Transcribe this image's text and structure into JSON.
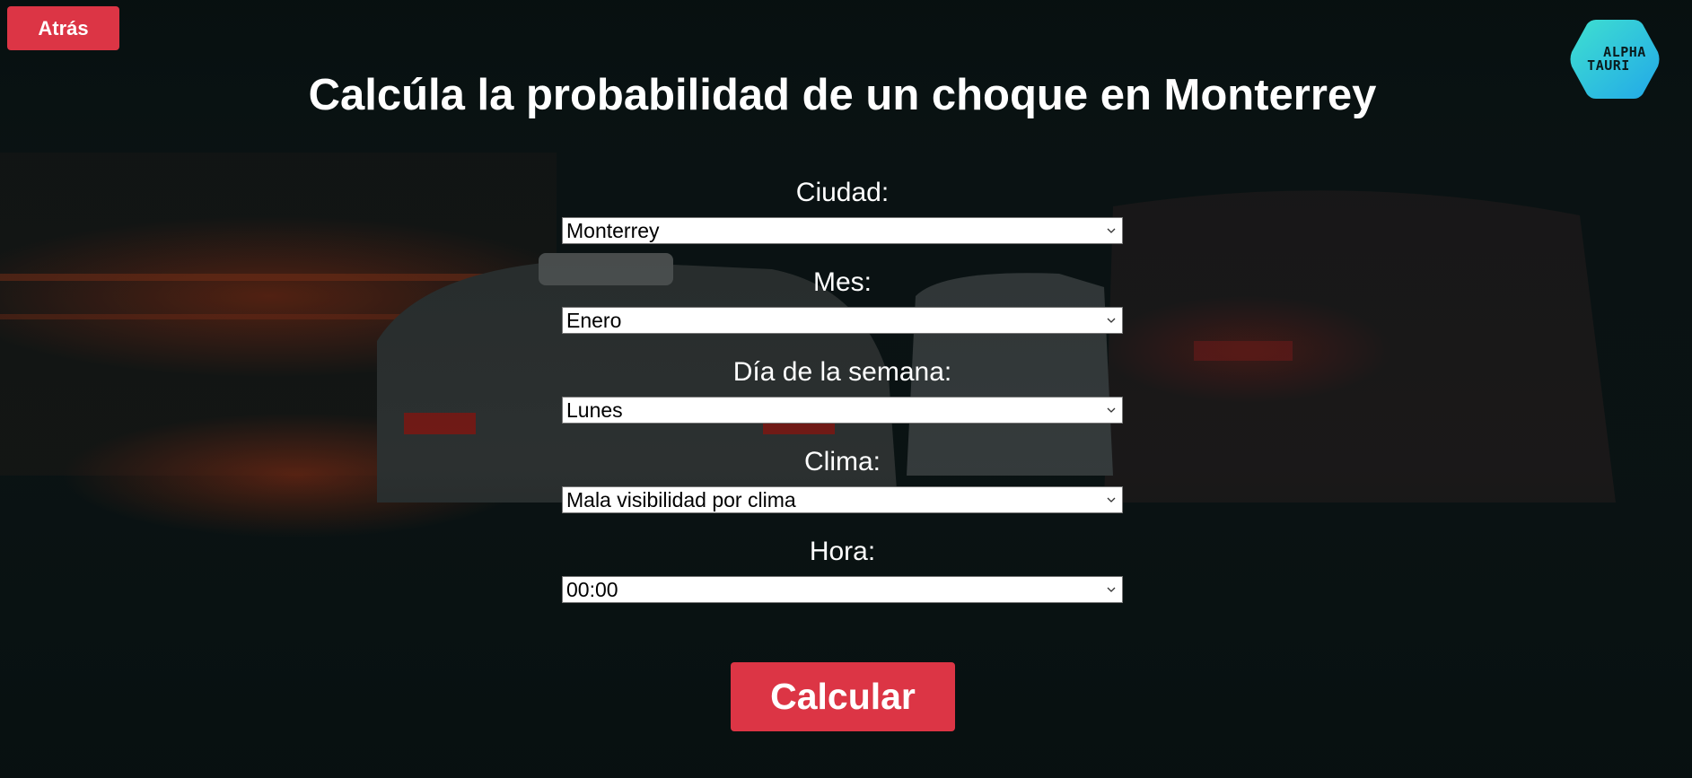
{
  "header": {
    "back_label": "Atrás",
    "title": "Calcúla la probabilidad de un choque en Monterrey",
    "logo_line1": "ALPHA",
    "logo_line2": "TAURI"
  },
  "form": {
    "fields": [
      {
        "label": "Ciudad:",
        "value": "Monterrey"
      },
      {
        "label": "Mes:",
        "value": "Enero"
      },
      {
        "label": "Día de la semana:",
        "value": "Lunes"
      },
      {
        "label": "Clima:",
        "value": "Mala visibilidad por clima"
      },
      {
        "label": "Hora:",
        "value": "00:00"
      }
    ],
    "submit_label": "Calcular"
  },
  "colors": {
    "accent": "#dc3545",
    "background": "#0b1213",
    "logo_gradient_start": "#3fe0d0",
    "logo_gradient_end": "#22a8e8"
  },
  "icons": {
    "back": "none",
    "select_arrow": "chevron-down-icon",
    "logo": "hexagon-logo-icon"
  }
}
